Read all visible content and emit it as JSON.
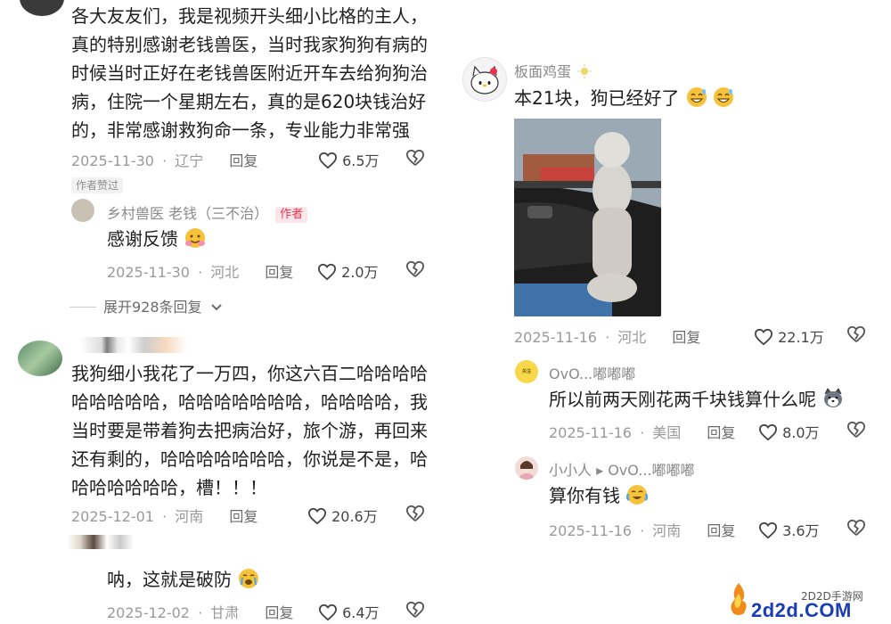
{
  "comments": [
    {
      "text": "各大友友们，我是视频开头细小比格的主人，真的特别感谢老钱兽医，当时我家狗狗有病的时候当时正好在老钱兽医附近开车去给狗狗治病，住院一个星期左右，真的是620块钱治好的，非常感谢救狗命一条，专业能力非常强",
      "lines": [
        "各大友友们，我是视频开头细小比格的主人，",
        "真的特别感谢老钱兽医，当时我家狗狗有病的",
        "时候当时正好在老钱兽医附近开车去给狗狗治",
        "病，住院一个星期左右，真的是620块钱治好",
        "的，非常感谢救狗命一条，专业能力非常强"
      ],
      "date": "2025-11-30",
      "region": "辽宁",
      "reply": "回复",
      "likes": "6.5万",
      "liked_tag": "作者赞过",
      "reply_item": {
        "name": "乡村兽医  老钱（三不治）",
        "tag": "作者",
        "text": "感谢反馈",
        "date": "2025-11-30",
        "region": "河北",
        "reply": "回复",
        "likes": "2.0万"
      },
      "expand": "展开928条回复"
    },
    {
      "lines": [
        "我狗细小我花了一万四，你这六百二哈哈哈哈",
        "哈哈哈哈哈，哈哈哈哈哈哈哈，哈哈哈哈，我",
        "当时要是带着狗去把病治好，旅个游，再回来",
        "还有剩的，哈哈哈哈哈哈哈，你说是不是，哈",
        "哈哈哈哈哈哈，槽！！！"
      ],
      "date": "2025-12-01",
      "region": "河南",
      "reply": "回复",
      "likes": "20.6万",
      "reply_item": {
        "text": "呐，这就是破防",
        "date": "2025-12-02",
        "region": "甘肃",
        "reply": "回复",
        "likes": "6.4万"
      }
    },
    {
      "name": "板面鸡蛋",
      "text": "本21块，狗已经好了",
      "date": "2025-11-16",
      "region": "河北",
      "reply": "回复",
      "likes": "22.1万",
      "replies": [
        {
          "name": "OvO...嘟嘟嘟",
          "text": "所以前两天刚花两千块钱算什么呢",
          "date": "2025-11-16",
          "region": "美国",
          "reply": "回复",
          "likes": "8.0万"
        },
        {
          "name": "小小人 ▸ OvO...嘟嘟嘟",
          "text": "算你有钱",
          "date": "2025-11-16",
          "region": "河南",
          "reply": "回复",
          "likes": "3.6万"
        }
      ]
    }
  ],
  "watermark": {
    "small": "2D2D手游网",
    "logo": "2d2d.COM"
  },
  "colors": {
    "text": "#1f1f1f",
    "meta": "#9a9a9a",
    "author_red": "#e8344e",
    "watermark_blue": "#1a3fb5"
  }
}
